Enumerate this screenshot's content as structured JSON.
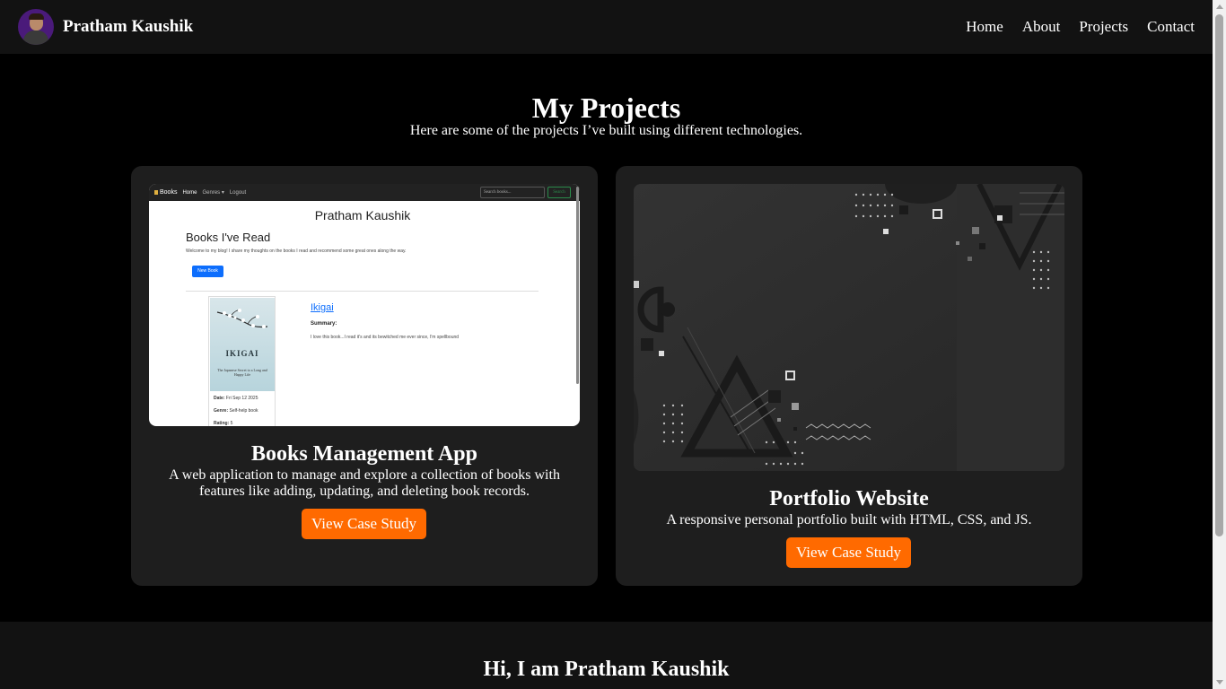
{
  "navbar": {
    "brand": "Pratham Kaushik",
    "links": [
      "Home",
      "About",
      "Projects",
      "Contact"
    ]
  },
  "projects_section": {
    "title": "My Projects",
    "subtitle": "Here are some of the projects I’ve built using different technologies."
  },
  "projects": [
    {
      "title": "Books Management App",
      "description": "A web application to manage and explore a collection of books with features like adding, updating, and deleting book records.",
      "button": "View Case Study",
      "screenshot": {
        "nav_brand": "Books",
        "nav_links": [
          "Home",
          "Genres ▾",
          "Logout"
        ],
        "search_placeholder": "Search books...",
        "search_button": "Search",
        "site_title": "Pratham Kaushik",
        "heading": "Books I've Read",
        "intro": "Welcome to my blog! I share my thoughts on the books I read and recommend some great ones along the way.",
        "new_button": "New Book",
        "book": {
          "cover_header": "THE INTERNATIONAL BESTSELLER",
          "cover_title": "IKIGAI",
          "cover_sub": "The Japanese Secret to a Long and Happy Life",
          "date_label": "Date:",
          "date": "Fri Sep 12 2025",
          "genre_label": "Genre:",
          "genre": "Self-help book",
          "rating_label": "Rating:",
          "rating": "5",
          "title": "Ikigai",
          "summary_label": "Summary:",
          "summary": "I love this book...I read it's and its bewitched me ever since, I'm spellbound"
        }
      }
    },
    {
      "title": "Portfolio Website",
      "description": "A responsive personal portfolio built with HTML, CSS, and JS.",
      "button": "View Case Study"
    }
  ],
  "about_section": {
    "title": "Hi, I am Pratham Kaushik"
  },
  "colors": {
    "accent": "#ff6a00",
    "page_bg": "#000000",
    "nav_bg": "#121212",
    "card_bg": "#1e1e1e"
  }
}
